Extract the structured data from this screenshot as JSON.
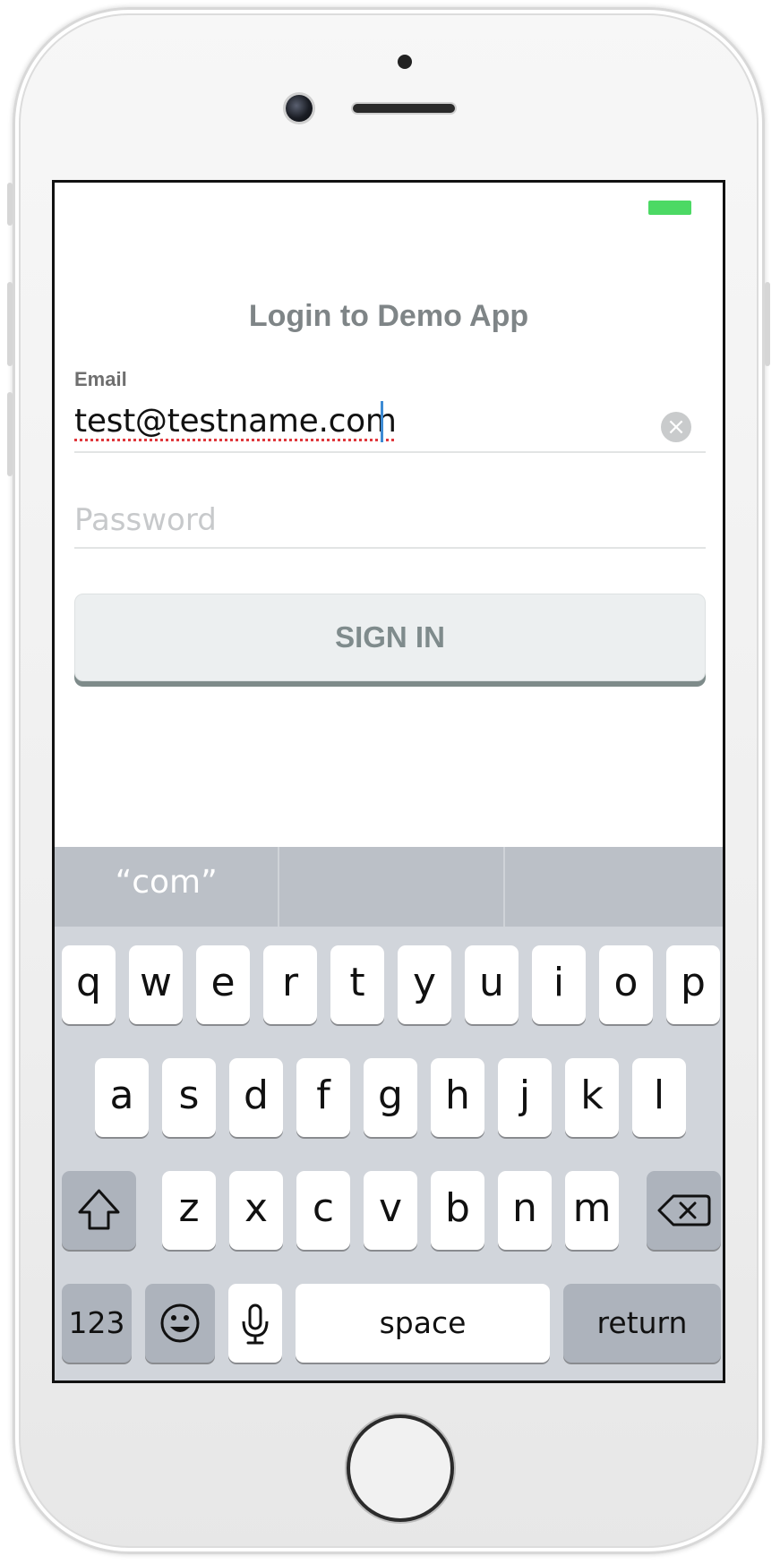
{
  "app": {
    "title": "Login to Demo App"
  },
  "email": {
    "label": "Email",
    "value": "test@testname.com"
  },
  "password": {
    "placeholder": "Password"
  },
  "sign_in": {
    "label": "SIGN IN"
  },
  "keyboard": {
    "suggestions": [
      "“com”",
      "",
      ""
    ],
    "row1": [
      "q",
      "w",
      "e",
      "r",
      "t",
      "y",
      "u",
      "i",
      "o",
      "p"
    ],
    "row2": [
      "a",
      "s",
      "d",
      "f",
      "g",
      "h",
      "j",
      "k",
      "l"
    ],
    "row3": [
      "z",
      "x",
      "c",
      "v",
      "b",
      "n",
      "m"
    ],
    "numbers_label": "123",
    "space_label": "space",
    "return_label": "return"
  },
  "colors": {
    "battery": "#4cd964",
    "caret": "#3d8bd4",
    "button_shadow": "#7e8b8a"
  },
  "icons": [
    "clear-icon",
    "shift-icon",
    "delete-icon",
    "emoji-icon",
    "microphone-icon",
    "battery-icon",
    "home-button"
  ]
}
